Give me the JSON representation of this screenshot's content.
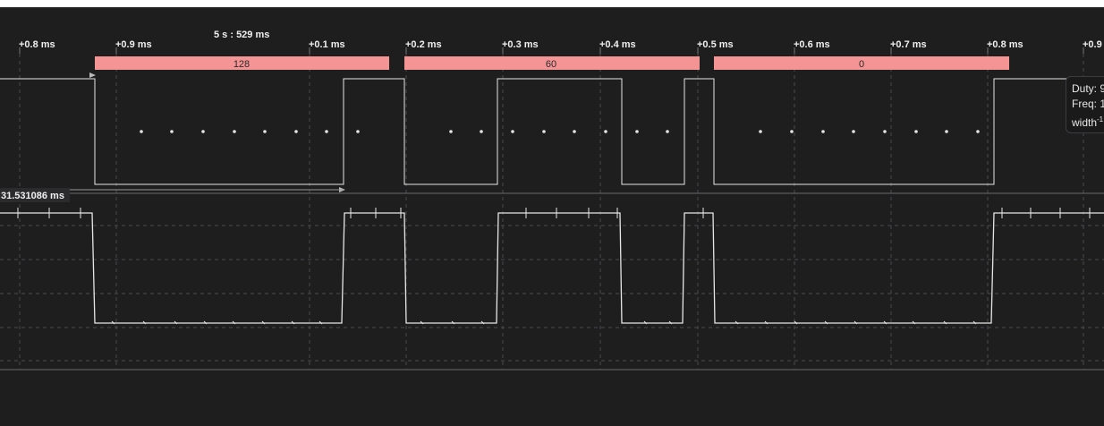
{
  "ruler": {
    "anchor_label": "5 s : 529 ms",
    "ticks": [
      "+0.8 ms",
      "+0.9 ms",
      "+0.1 ms",
      "+0.2 ms",
      "+0.3 ms",
      "+0.4 ms",
      "+0.5 ms",
      "+0.6 ms",
      "+0.7 ms",
      "+0.8 ms",
      "+0.9"
    ]
  },
  "decoder": {
    "values": [
      "128",
      "60",
      "0"
    ],
    "bar_color": "#f59494"
  },
  "measurement": {
    "label": "31.531086 ms"
  },
  "tooltip": {
    "duty": "Duty: 9",
    "freq": "Freq: 1.",
    "width": "width"
  },
  "colors": {
    "background": "#1e1e1f",
    "trace": "#e6e6e6",
    "grid": "#4a4a4c"
  }
}
